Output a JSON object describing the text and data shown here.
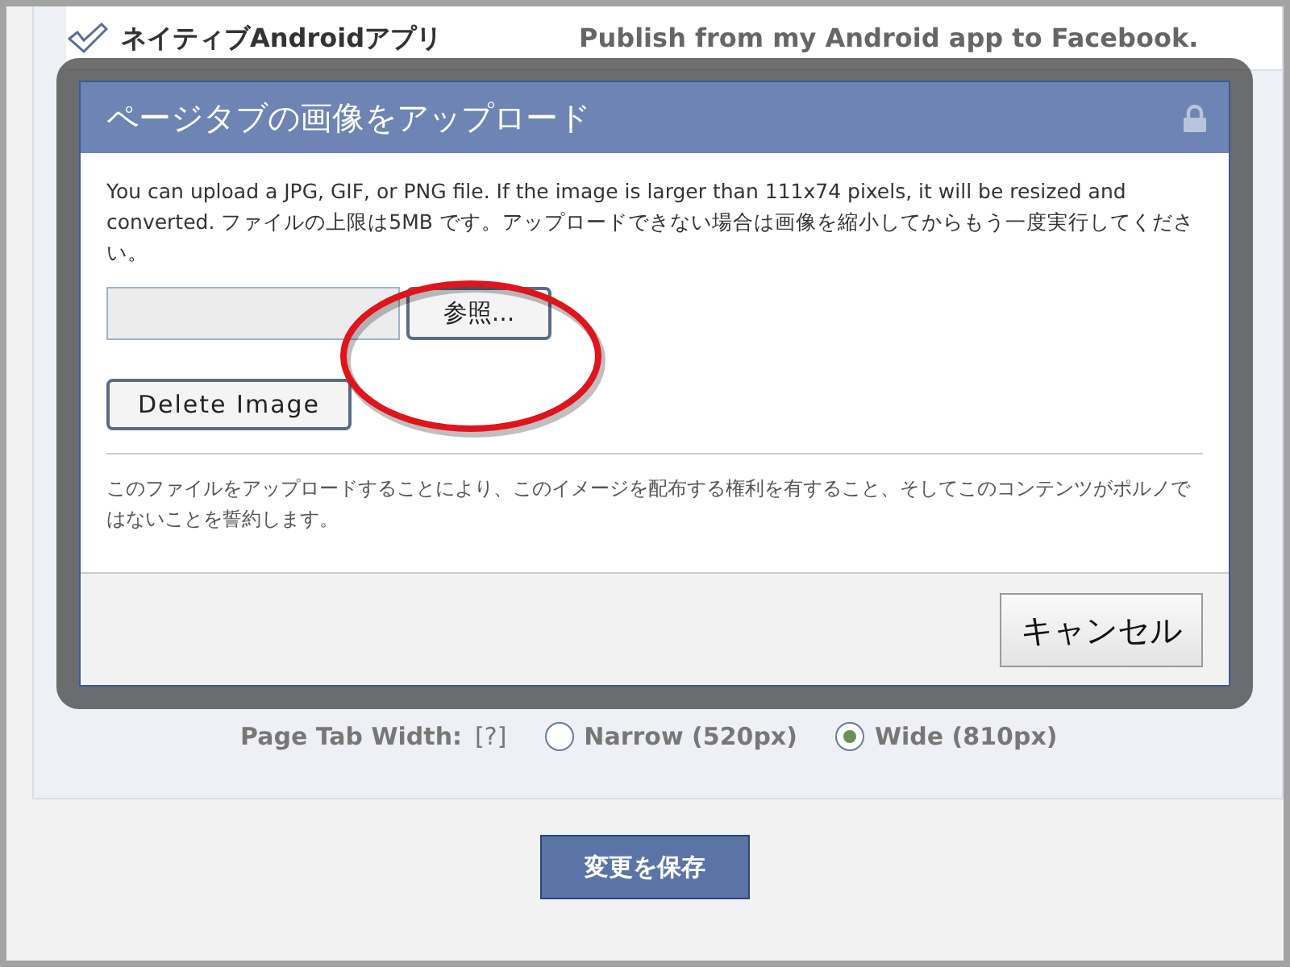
{
  "background_page": {
    "app_row": {
      "checked": true,
      "name": "ネイティブAndroidアプリ",
      "description": "Publish from my Android app to Facebook."
    },
    "page_tab_width": {
      "label": "Page Tab Width:",
      "help": "[?]",
      "options": [
        {
          "label": "Narrow (520px)",
          "selected": false
        },
        {
          "label": "Wide (810px)",
          "selected": true
        }
      ]
    },
    "save_button": "変更を保存"
  },
  "dialog": {
    "title": "ページタブの画像をアップロード",
    "description": "You can upload a JPG, GIF, or PNG file. If the image is larger than 111x74 pixels, it will be resized and converted. ファイルの上限は5MB です。アップロードできない場合は画像を縮小してからもう一度実行してください。",
    "browse_button": "参照...",
    "delete_button": "Delete Image",
    "notice": "このファイルをアップロードすることにより、このイメージを配布する権利を有すること、そしてこのコンテンツがポルノではないことを誓約します。",
    "cancel_button": "キャンセル"
  }
}
